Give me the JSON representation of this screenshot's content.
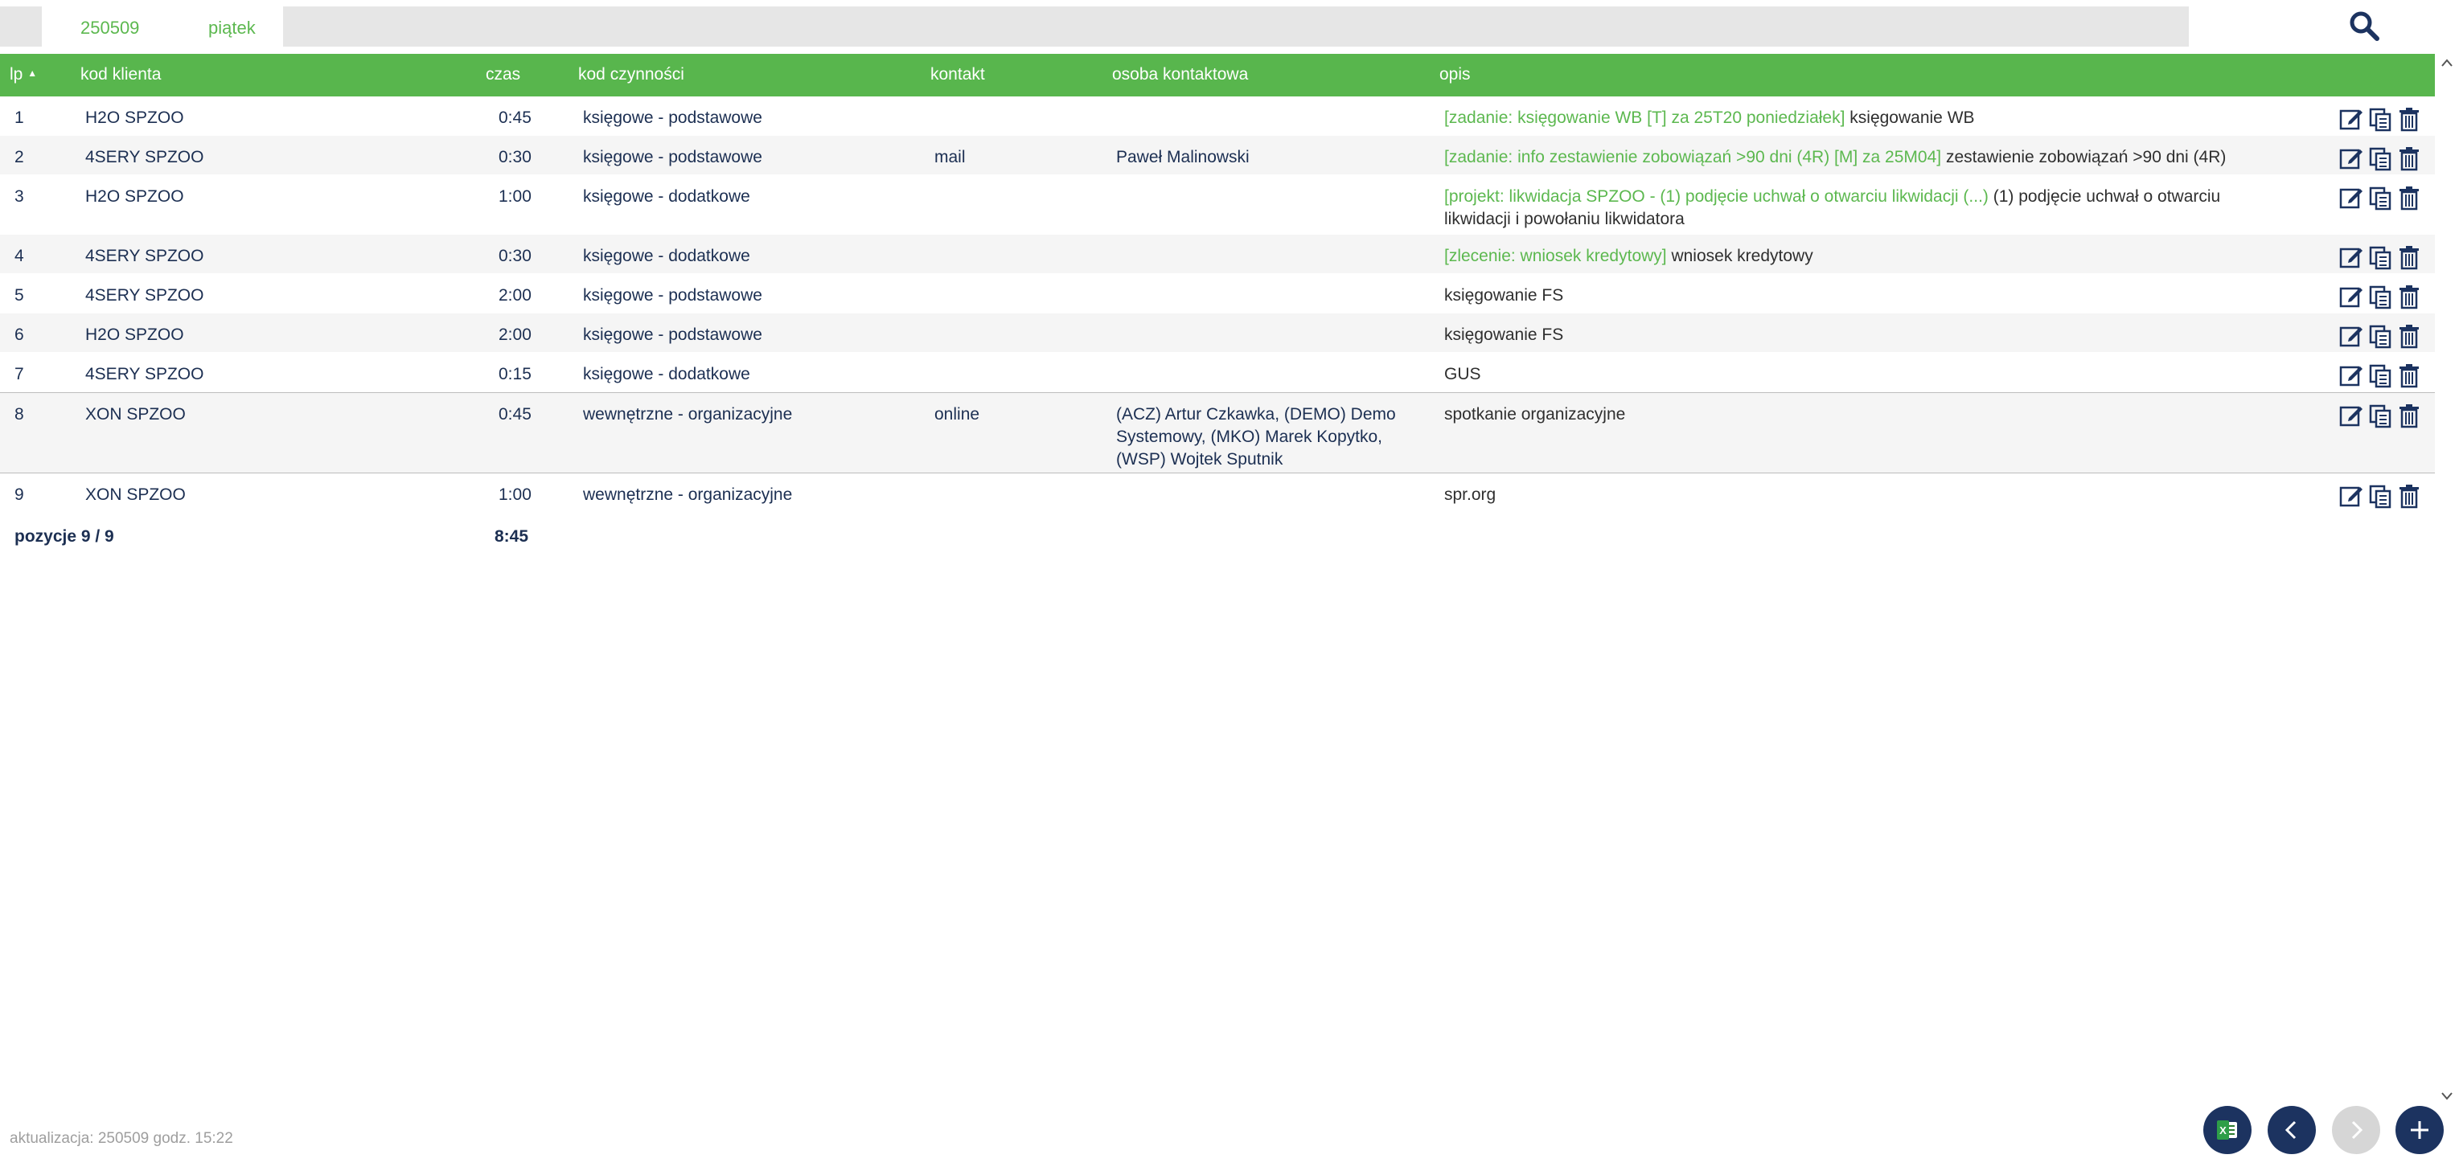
{
  "topbar": {
    "date": "250509",
    "weekday": "piątek",
    "search_icon": "search-icon"
  },
  "table": {
    "headers": {
      "lp": "lp",
      "lp_sort": "▲",
      "client": "kod klienta",
      "time": "czas",
      "activity": "kod czynności",
      "contact": "kontakt",
      "person": "osoba kontaktowa",
      "desc": "opis"
    },
    "rows": [
      {
        "lp": "1",
        "client": "H2O SPZOO",
        "time": "0:45",
        "activity": "księgowe - podstawowe",
        "contact": "",
        "person": "",
        "desc_tag": "[zadanie: księgowanie WB [T] za 25T20 poniedziałek]",
        "desc": " księgowanie WB"
      },
      {
        "lp": "2",
        "client": "4SERY SPZOO",
        "time": "0:30",
        "activity": "księgowe - podstawowe",
        "contact": "mail",
        "person": "Paweł Malinowski",
        "desc_tag": "[zadanie: info zestawienie zobowiązań >90 dni (4R) [M] za 25M04]",
        "desc": " zestawienie zobowiązań >90 dni (4R)"
      },
      {
        "lp": "3",
        "client": "H2O SPZOO",
        "time": "1:00",
        "activity": "księgowe - dodatkowe",
        "contact": "",
        "person": "",
        "desc_tag": "[projekt: likwidacja SPZOO - (1) podjęcie uchwał o otwarciu likwidacji (...)",
        "desc": " (1) podjęcie uchwał o otwarciu likwidacji i powołaniu likwidatora"
      },
      {
        "lp": "4",
        "client": "4SERY SPZOO",
        "time": "0:30",
        "activity": "księgowe - dodatkowe",
        "contact": "",
        "person": "",
        "desc_tag": "[zlecenie: wniosek kredytowy]",
        "desc": " wniosek kredytowy"
      },
      {
        "lp": "5",
        "client": "4SERY SPZOO",
        "time": "2:00",
        "activity": "księgowe - podstawowe",
        "contact": "",
        "person": "",
        "desc_tag": "",
        "desc": "księgowanie FS"
      },
      {
        "lp": "6",
        "client": "H2O SPZOO",
        "time": "2:00",
        "activity": "księgowe - podstawowe",
        "contact": "",
        "person": "",
        "desc_tag": "",
        "desc": "księgowanie FS"
      },
      {
        "lp": "7",
        "client": "4SERY SPZOO",
        "time": "0:15",
        "activity": "księgowe - dodatkowe",
        "contact": "",
        "person": "",
        "desc_tag": "",
        "desc": "GUS"
      },
      {
        "lp": "8",
        "client": "XON SPZOO",
        "time": "0:45",
        "activity": "wewnętrzne - organizacyjne",
        "contact": "online",
        "person": "(ACZ) Artur Czkawka, (DEMO) Demo Systemowy, (MKO) Marek Kopytko, (WSP) Wojtek Sputnik",
        "desc_tag": "",
        "desc": "spotkanie organizacyjne"
      },
      {
        "lp": "9",
        "client": "XON SPZOO",
        "time": "1:00",
        "activity": "wewnętrzne - organizacyjne",
        "contact": "",
        "person": "",
        "desc_tag": "",
        "desc": "spr.org"
      }
    ],
    "row_actions": [
      "edit-icon",
      "copy-icon",
      "delete-icon"
    ]
  },
  "summary": {
    "positions": "pozycje 9 / 9",
    "total_time": "8:45"
  },
  "footer": {
    "updated": "aktualizacja: 250509 godz. 15:22",
    "buttons": [
      "excel-icon",
      "chevron-left-icon",
      "chevron-right-icon",
      "plus-icon"
    ]
  },
  "colors": {
    "header_green": "#58b64d",
    "tag_green": "#5cb84f",
    "navy": "#1c3360"
  }
}
